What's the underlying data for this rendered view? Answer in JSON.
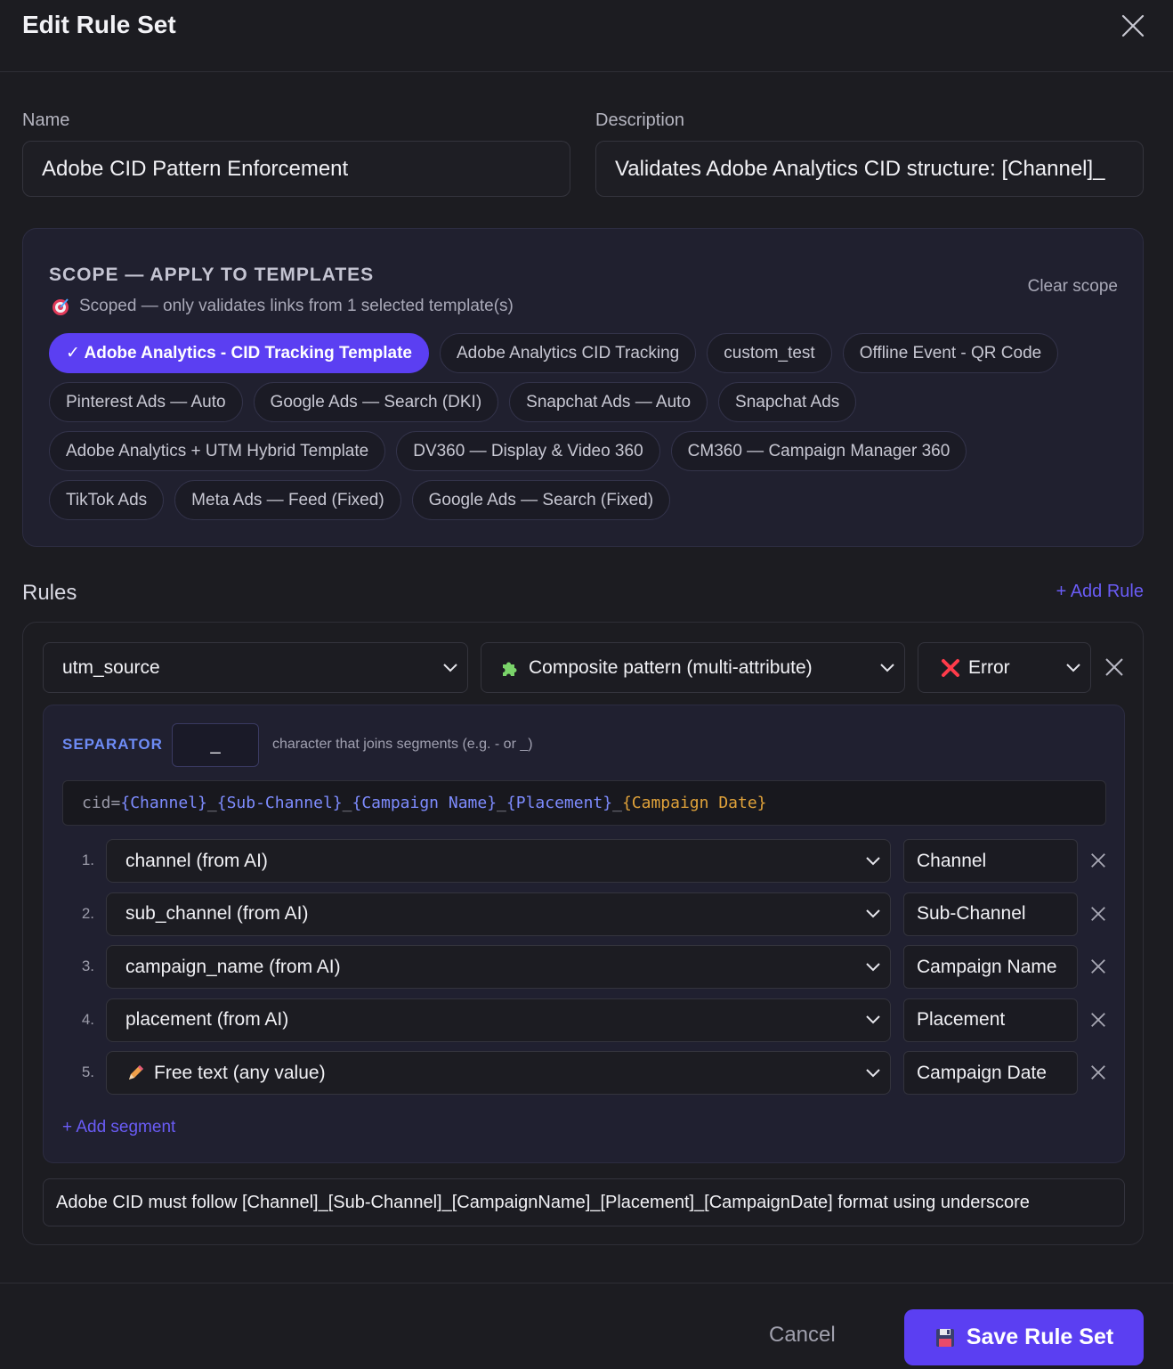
{
  "dialog": {
    "title": "Edit Rule Set",
    "close_icon": "close-icon"
  },
  "form": {
    "name_label": "Name",
    "name_value": "Adobe CID Pattern Enforcement",
    "description_label": "Description",
    "description_value": "Validates Adobe Analytics CID structure: [Channel]_"
  },
  "scope": {
    "heading": "SCOPE — APPLY TO TEMPLATES",
    "subtitle": "Scoped — only validates links from 1 selected template(s)",
    "subtitle_icon": "target-icon",
    "clear_label": "Clear scope",
    "rows": [
      [
        {
          "label": "✓ Adobe Analytics - CID Tracking Template",
          "selected": true
        },
        {
          "label": "Adobe Analytics CID Tracking",
          "selected": false
        },
        {
          "label": "custom_test",
          "selected": false
        },
        {
          "label": "Offline Event - QR Code",
          "selected": false
        }
      ],
      [
        {
          "label": "Pinterest Ads — Auto",
          "selected": false
        },
        {
          "label": "Google Ads — Search (DKI)",
          "selected": false
        },
        {
          "label": "Snapchat Ads — Auto",
          "selected": false
        },
        {
          "label": "Snapchat Ads",
          "selected": false
        }
      ],
      [
        {
          "label": "Adobe Analytics + UTM Hybrid Template",
          "selected": false
        },
        {
          "label": "DV360 — Display & Video 360",
          "selected": false
        },
        {
          "label": "CM360 — Campaign Manager 360",
          "selected": false
        }
      ],
      [
        {
          "label": "TikTok Ads",
          "selected": false
        },
        {
          "label": "Meta Ads — Feed (Fixed)",
          "selected": false
        },
        {
          "label": "Google Ads — Search (Fixed)",
          "selected": false
        }
      ]
    ]
  },
  "rules": {
    "title": "Rules",
    "add_rule_label": "+ Add Rule",
    "rule": {
      "attribute": "utm_source",
      "type": "Composite pattern (multi-attribute)",
      "type_icon": "puzzle-icon",
      "severity": "Error",
      "severity_icon": "red-x-icon",
      "separator_label": "SEPARATOR",
      "separator_value": "_",
      "separator_help": "character that joins segments (e.g. - or _)",
      "preview": {
        "key": "cid",
        "eq": " = ",
        "segments": [
          "{Channel}",
          "{Sub-Channel}",
          "{Campaign Name}",
          "{Placement}"
        ],
        "last_segment": "{Campaign Date}",
        "sep": "_"
      },
      "segments": [
        {
          "num": "1.",
          "source": "channel (from AI)",
          "label": "Channel",
          "icon": ""
        },
        {
          "num": "2.",
          "source": "sub_channel (from AI)",
          "label": "Sub-Channel",
          "icon": ""
        },
        {
          "num": "3.",
          "source": "campaign_name (from AI)",
          "label": "Campaign Name",
          "icon": ""
        },
        {
          "num": "4.",
          "source": "placement (from AI)",
          "label": "Placement",
          "icon": ""
        },
        {
          "num": "5.",
          "source": "Free text (any value)",
          "label": "Campaign Date",
          "icon": "pencil-icon"
        }
      ],
      "add_segment_label": "+ Add segment",
      "message": "Adobe CID must follow [Channel]_[Sub-Channel]_[CampaignName]_[Placement]_[CampaignDate] format using underscore"
    }
  },
  "footer": {
    "cancel_label": "Cancel",
    "save_label": "Save Rule Set",
    "save_icon": "floppy-disk-icon"
  },
  "colors": {
    "accent": "#5b3ff2",
    "link": "#6a5cf6",
    "error": "#ff3b4a",
    "background": "#1c1c21"
  }
}
